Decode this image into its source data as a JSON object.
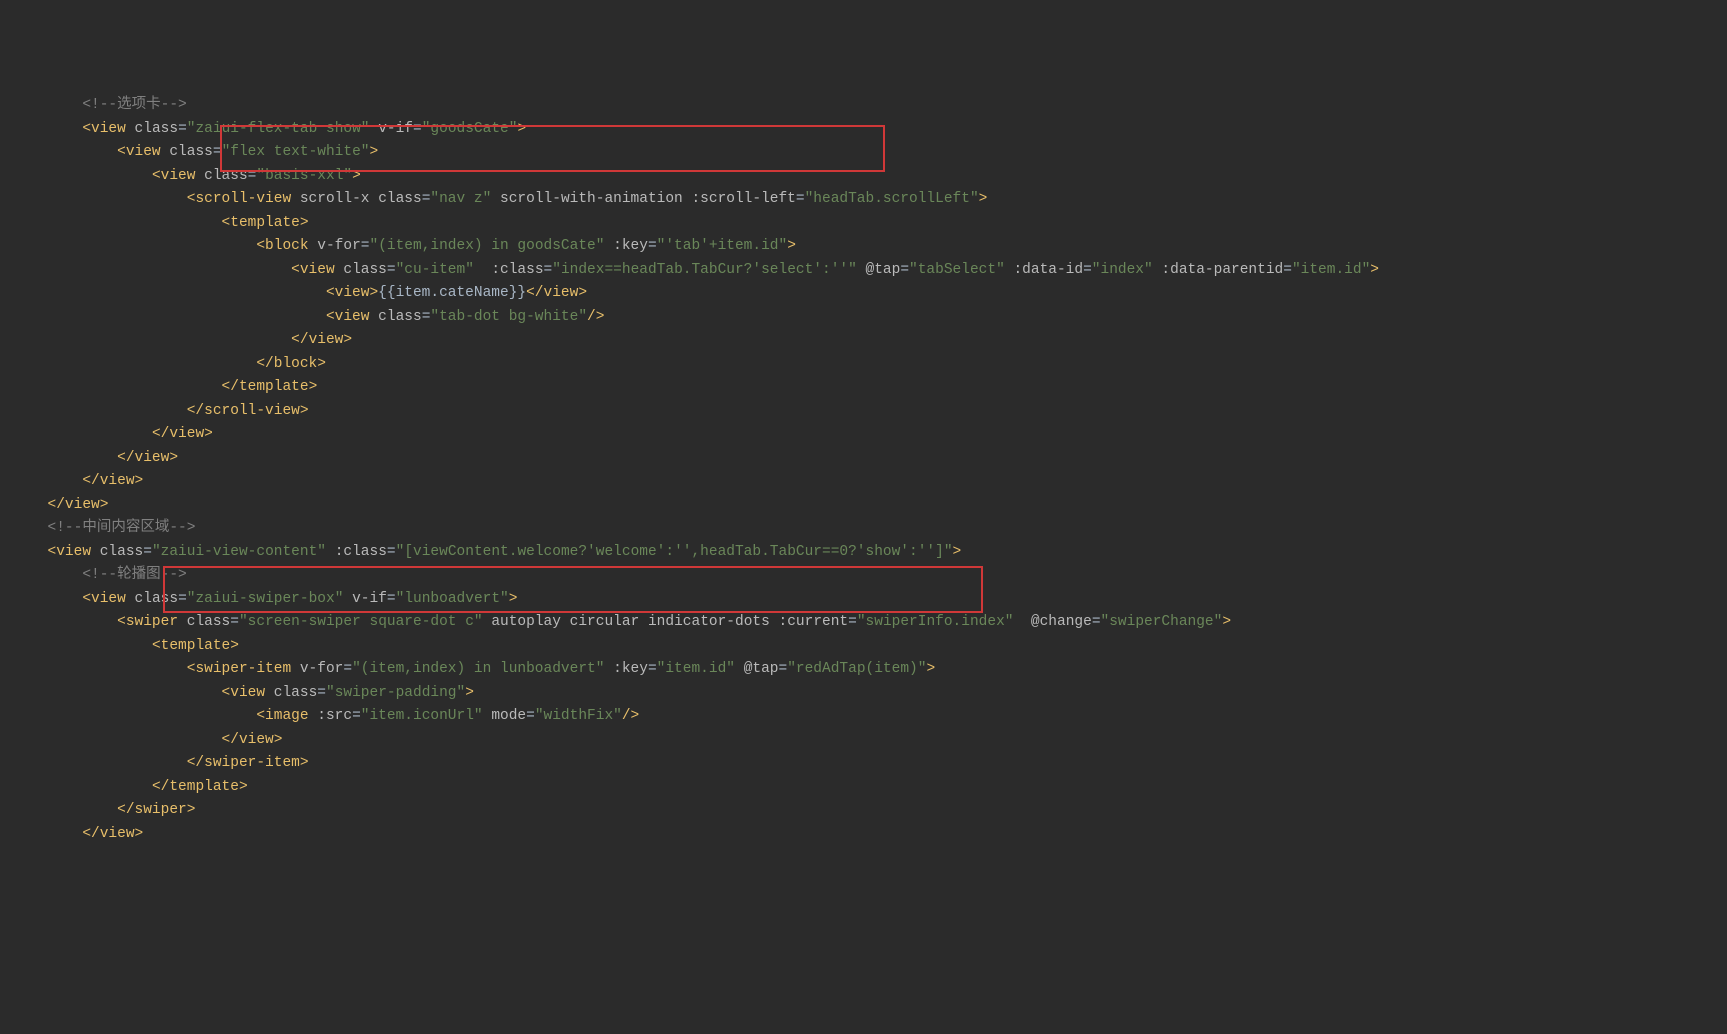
{
  "colors": {
    "background": "#2b2b2b",
    "comment": "#808080",
    "tag": "#e8bf6a",
    "attr": "#bababa",
    "string": "#6a8759",
    "directive": "#cc7832",
    "property": "#9876aa",
    "highlight_border": "#d03838"
  },
  "code": {
    "comments": {
      "tab_section": "<!--选项卡-->",
      "middle_section": "<!--中间内容区域-->",
      "swiper_section": "<!--轮播图-->"
    },
    "tags": {
      "view": "view",
      "scroll_view": "scroll-view",
      "template": "template",
      "block": "block",
      "swiper": "swiper",
      "swiper_item": "swiper-item",
      "image": "image"
    },
    "attrs": {
      "class": "class",
      "v_if": "v-if",
      "v_for": "v-for",
      "key": ":key",
      "scroll_x": "scroll-x",
      "scroll_with_animation": "scroll-with-animation",
      "scroll_left": ":scroll-left",
      "dyn_class": ":class",
      "tap": "@tap",
      "data_id": ":data-id",
      "data_parentid": ":data-parentid",
      "autoplay": "autoplay",
      "circular": "circular",
      "indicator_dots": "indicator-dots",
      "current": ":current",
      "change": "@change",
      "src": ":src",
      "mode": "mode"
    },
    "values": {
      "zaiui_flex_tab": "zaiui-flex-tab show",
      "goods_cate": "goodsCate",
      "flex_text_white": "flex text-white",
      "basis_xxl": "basis-xxl",
      "nav_z": "nav z",
      "head_tab_scroll": "headTab.scrollLeft",
      "vfor_expr1": "(item,index) in goodsCate",
      "key_expr1": "'tab'+item.id",
      "cu_item": "cu-item",
      "class_ternary": "index==headTab.TabCur?'select':''",
      "tab_select": "tabSelect",
      "index": "index",
      "item_id": "item.id",
      "item_catename": "{{item.cateName}}",
      "tab_dot": "tab-dot bg-white",
      "zaiui_view_content": "zaiui-view-content",
      "content_class_arr": "[viewContent.welcome?'welcome':'',headTab.TabCur==0?'show':'']",
      "zaiui_swiper_box": "zaiui-swiper-box",
      "lunboadvert": "lunboadvert",
      "screen_swiper": "screen-swiper square-dot c",
      "swiper_info_index": "swiperInfo.index",
      "swiper_change": "swiperChange",
      "vfor_expr2": "(item,index) in lunboadvert",
      "key_expr2": "item.id",
      "red_ad_tap": "redAdTap(item)",
      "swiper_padding": "swiper-padding",
      "item_iconurl": "item.iconUrl",
      "width_fix": "widthFix"
    }
  }
}
